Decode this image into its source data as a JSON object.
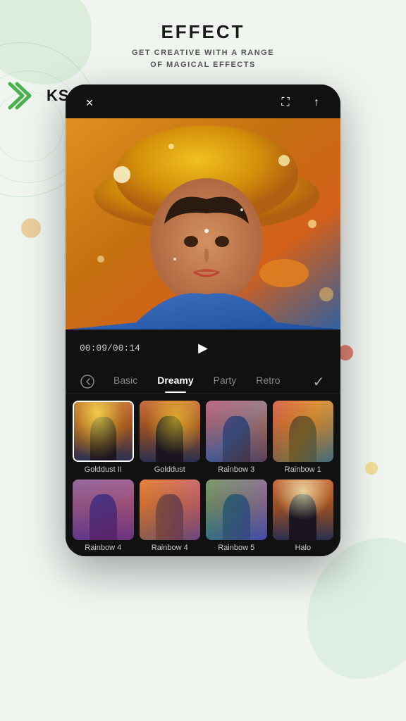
{
  "page": {
    "background_color": "#f0f5f0"
  },
  "header": {
    "title": "EFFECT",
    "subtitle_line1": "GET CREATIVE WITH A RANGE",
    "subtitle_line2": "OF MAGICAL EFFECTS"
  },
  "watermark": {
    "brand": "KSAPK"
  },
  "phone": {
    "topbar": {
      "close_icon": "×",
      "expand_icon": "⛶",
      "share_icon": "↑"
    },
    "playback": {
      "time_current": "00:09",
      "time_total": "00:14",
      "time_display": "00:09/00:14",
      "play_icon": "▶"
    },
    "tabs": {
      "back_icon": "↺",
      "items": [
        {
          "label": "Basic",
          "active": false
        },
        {
          "label": "Dreamy",
          "active": true
        },
        {
          "label": "Party",
          "active": false
        },
        {
          "label": "Retro",
          "active": false
        }
      ],
      "confirm_icon": "✓"
    },
    "effects_row1": [
      {
        "label": "Golddust II",
        "selected": true,
        "overlay": "golddust2"
      },
      {
        "label": "Golddust",
        "selected": false,
        "overlay": "golddust"
      },
      {
        "label": "Rainbow 3",
        "selected": false,
        "overlay": "rainbow3"
      },
      {
        "label": "Rainbow 1",
        "selected": false,
        "overlay": "rainbow1"
      }
    ],
    "effects_row2": [
      {
        "label": "Rainbow 4",
        "selected": false,
        "overlay": "rainbow4a"
      },
      {
        "label": "Rainbow 4",
        "selected": false,
        "overlay": "rainbow4b"
      },
      {
        "label": "Rainbow 5",
        "selected": false,
        "overlay": "rainbow5"
      },
      {
        "label": "Halo",
        "selected": false,
        "overlay": "halo"
      }
    ]
  }
}
